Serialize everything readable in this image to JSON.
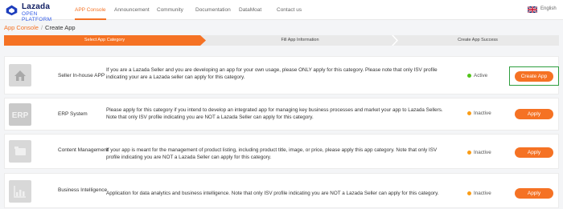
{
  "brand": {
    "name": "Lazada",
    "subtitle": "OPEN PLATFORM"
  },
  "nav": [
    "APP Console",
    "Announcement",
    "Community",
    "Documentation",
    "DataMoat",
    "Contact us"
  ],
  "language": "English",
  "breadcrumb": {
    "root": "App Console",
    "separator": "/",
    "current": "Create App"
  },
  "steps": [
    "Select App Category",
    "Fill App Information",
    "Create App Success"
  ],
  "colors": {
    "accent": "#f57224",
    "active": "#52c41a",
    "inactive": "#fa9c16",
    "highlight": "#2e9e3e"
  },
  "cards": [
    {
      "icon": "home-icon",
      "name": "Seller In-house APP",
      "description": "If you are a Lazada Seller and you are developing an app for your own usage, please ONLY apply for this category. Please note that only ISV profile indicating your are a Lazada seller can apply for this category.",
      "status": "Active",
      "button": "Create App"
    },
    {
      "icon": "erp-icon",
      "name": "ERP System",
      "description": "Please apply for this category if you intend to develop an integrated app for managing key business processes and market your app to Lazada Sellers. Note that only ISV profile indicating you are NOT a Lazada Seller can apply for this category.",
      "status": "Inactive",
      "button": "Apply"
    },
    {
      "icon": "content-icon",
      "name": "Content Management",
      "description": "If your app is meant for the management of product listing, including product title, image, or price, please apply this app category. Note that only ISV profile indicating you are NOT a Lazada Seller can apply for this category.",
      "status": "Inactive",
      "button": "Apply"
    },
    {
      "icon": "chart-icon",
      "name": "Business Intelligence",
      "description": "Application for data analytics and business intelligence. Note that only ISV profile indicating you are NOT a Lazada Seller can apply for this category.",
      "status": "Inactive",
      "button": "Apply"
    }
  ]
}
